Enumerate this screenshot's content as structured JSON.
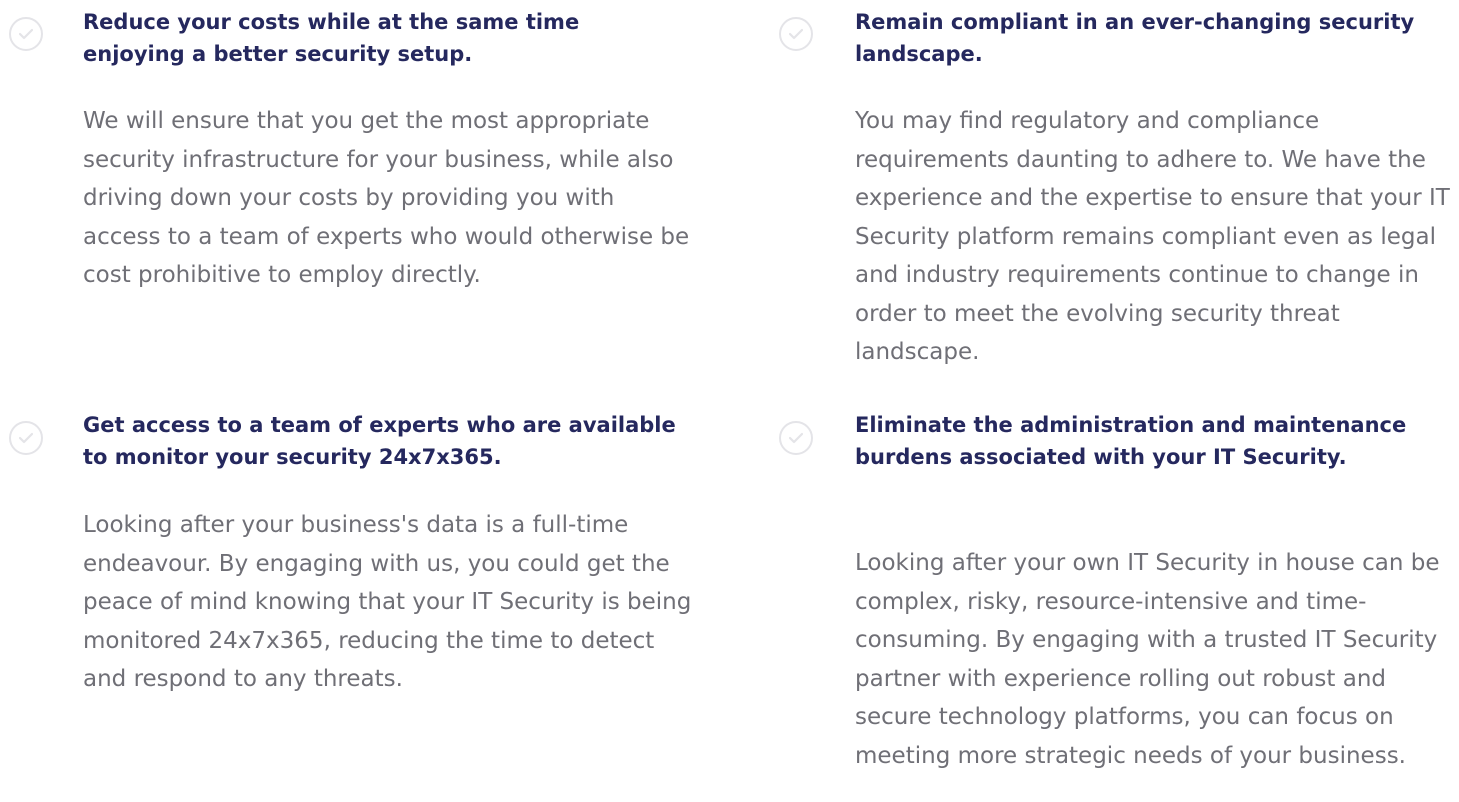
{
  "icons": {
    "check": "check-circle-icon"
  },
  "colors": {
    "heading": "#25285e",
    "body": "#6f6f76",
    "icon_ring": "#e4e4e8"
  },
  "features": [
    {
      "title": "Reduce your costs while at the same time enjoying a better security setup.",
      "description": "We will ensure that you get the most appropriate security infrastructure for your business, while also driving down your costs by providing you with access to a team of experts who would otherwise be cost prohibitive to employ directly."
    },
    {
      "title": "Remain compliant in an ever-changing security landscape.",
      "description": "You may find regulatory and compliance requirements daunting to adhere to. We have the experience and the expertise to ensure that your IT Security platform remains compliant even as legal and industry requirements continue to change in order to meet the evolving security threat landscape."
    },
    {
      "title": "Get access to a team of experts who are available to monitor your security 24x7x365.",
      "description": "Looking after your business's data is a full-time endeavour. By engaging with us, you could get the peace of mind knowing that your IT Security is being monitored 24x7x365, reducing the time to detect and respond to any threats."
    },
    {
      "title": "Eliminate the administration and maintenance burdens associated with your IT Security.",
      "description": "Looking after your own IT Security in house can be complex, risky, resource-intensive and time-consuming. By engaging with a trusted IT Security partner with experience rolling out robust and secure technology platforms, you can focus on meeting more strategic needs of your business."
    }
  ]
}
